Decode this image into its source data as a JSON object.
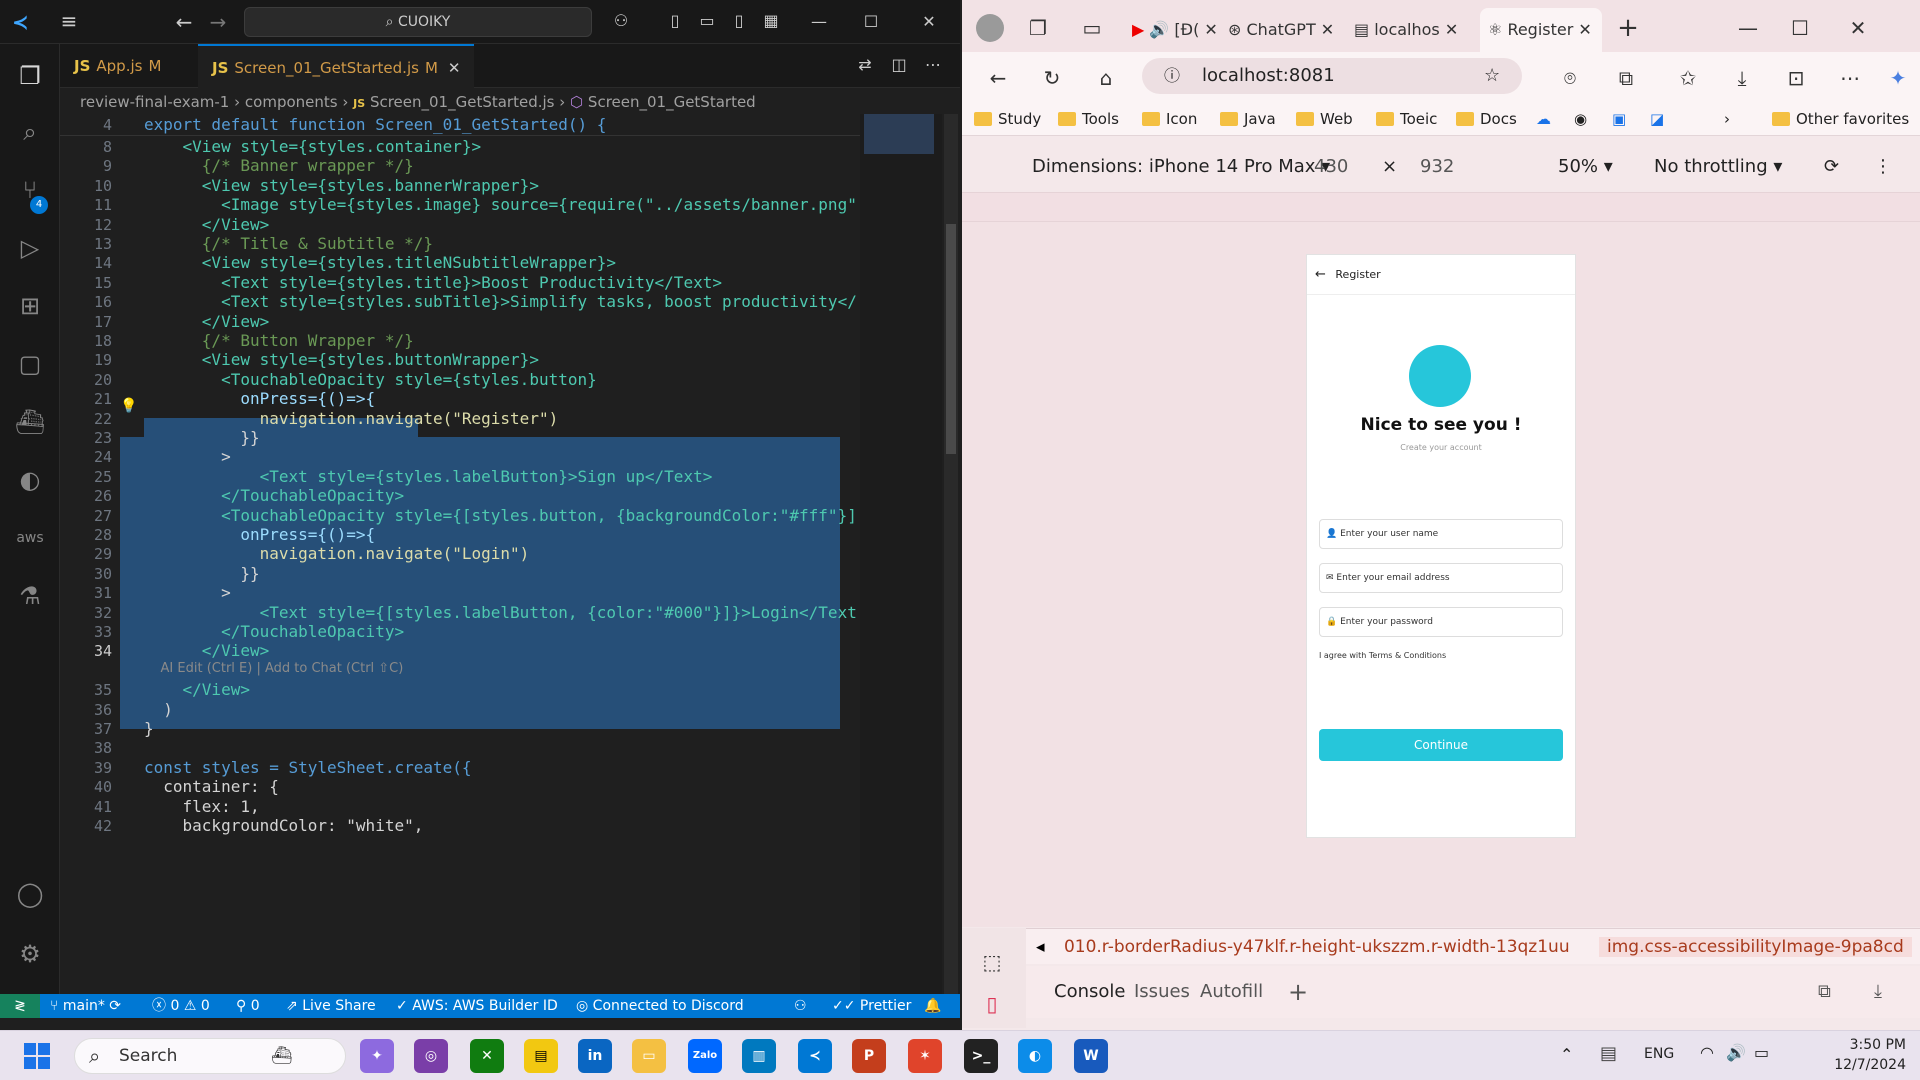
{
  "vscode": {
    "command_center": "CUOIKY",
    "tabs": [
      {
        "name": "App.js",
        "status": "M"
      },
      {
        "name": "Screen_01_GetStarted.js",
        "status": "M"
      }
    ],
    "breadcrumb": [
      "review-final-exam-1",
      "components",
      "Screen_01_GetStarted.js",
      "Screen_01_GetStarted"
    ],
    "sticky_line": {
      "num": "4",
      "text": "export default function Screen_01_GetStarted() {"
    },
    "lines": [
      {
        "n": "8",
        "t": "    <View style={styles.container}>"
      },
      {
        "n": "9",
        "t": "      {/* Banner wrapper */}"
      },
      {
        "n": "10",
        "t": "      <View style={styles.bannerWrapper}>"
      },
      {
        "n": "11",
        "t": "        <Image style={styles.image} source={require(\"../assets/banner.png\""
      },
      {
        "n": "12",
        "t": "      </View>"
      },
      {
        "n": "13",
        "t": "      {/* Title & Subtitle */}"
      },
      {
        "n": "14",
        "t": "      <View style={styles.titleNSubtitleWrapper}>"
      },
      {
        "n": "15",
        "t": "        <Text style={styles.title}>Boost Productivity</Text>"
      },
      {
        "n": "16",
        "t": "        <Text style={styles.subTitle}>Simplify tasks, boost productivity</"
      },
      {
        "n": "17",
        "t": "      </View>"
      },
      {
        "n": "18",
        "t": "      {/* Button Wrapper */}"
      },
      {
        "n": "19",
        "t": "      <View style={styles.buttonWrapper}>"
      },
      {
        "n": "20",
        "t": "        <TouchableOpacity style={styles.button}"
      },
      {
        "n": "21",
        "t": "          onPress={()=>{"
      },
      {
        "n": "22",
        "t": "            navigation.navigate(\"Register\")"
      },
      {
        "n": "23",
        "t": "          }}"
      },
      {
        "n": "24",
        "t": "        >"
      },
      {
        "n": "25",
        "t": "            <Text style={styles.labelButton}>Sign up</Text>"
      },
      {
        "n": "26",
        "t": "        </TouchableOpacity>"
      },
      {
        "n": "27",
        "t": "        <TouchableOpacity style={[styles.button, {backgroundColor:\"#fff\"}]"
      },
      {
        "n": "28",
        "t": "          onPress={()=>{"
      },
      {
        "n": "29",
        "t": "            navigation.navigate(\"Login\")"
      },
      {
        "n": "30",
        "t": "          }}"
      },
      {
        "n": "31",
        "t": "        >"
      },
      {
        "n": "32",
        "t": "            <Text style={[styles.labelButton, {color:\"#000\"}]}>Login</Text"
      },
      {
        "n": "33",
        "t": "        </TouchableOpacity>"
      },
      {
        "n": "34",
        "t": "      </View>"
      },
      {
        "n": "",
        "t": "    AI Edit (Ctrl E) | Add to Chat (Ctrl ⇧C)"
      },
      {
        "n": "35",
        "t": "    </View>"
      },
      {
        "n": "36",
        "t": "  )"
      },
      {
        "n": "37",
        "t": "}"
      },
      {
        "n": "38",
        "t": ""
      },
      {
        "n": "39",
        "t": "const styles = StyleSheet.create({"
      },
      {
        "n": "40",
        "t": "  container: {"
      },
      {
        "n": "41",
        "t": "    flex: 1,"
      },
      {
        "n": "42",
        "t": "    backgroundColor: \"white\","
      }
    ],
    "status": {
      "branch": "main*",
      "errors": "0",
      "warnings": "0",
      "ports": "0",
      "live_share": "Live Share",
      "aws": "AWS: AWS Builder ID",
      "discord": "Connected to Discord",
      "prettier": "Prettier"
    },
    "source_control_badge": "4"
  },
  "edge": {
    "tabs": [
      {
        "label": "[Đ("
      },
      {
        "label": "ChatGPT"
      },
      {
        "label": "localhos"
      },
      {
        "label": "Register"
      }
    ],
    "url": "localhost:8081",
    "favorites": [
      "Study",
      "Tools",
      "Icon",
      "Java",
      "Web",
      "Toeic",
      "Docs"
    ],
    "other_favorites": "Other favorites",
    "device": {
      "dimensions": "Dimensions: iPhone 14 Pro Max",
      "width": "430",
      "height": "932",
      "zoom": "50%",
      "throttling": "No throttling"
    },
    "app": {
      "header": "Register",
      "headline": "Nice to see you !",
      "subheadline": "Create your account",
      "username_placeholder": "Enter your user name",
      "email_placeholder": "Enter your email address",
      "password_placeholder": "Enter your password",
      "agree_text": "I agree with Terms & Conditions",
      "continue_label": "Continue"
    },
    "css_crumbs": [
      "010.r-borderRadius-y47klf.r-height-ukszzm.r-width-13qz1uu",
      "img.css-accessibilityImage-9pa8cd"
    ],
    "devtools_tabs": [
      "Console",
      "Issues",
      "Autofill"
    ]
  },
  "taskbar": {
    "search": "Search",
    "language": "ENG",
    "time": "3:50 PM",
    "date": "12/7/2024"
  },
  "colors": {
    "accent": "#0078d4",
    "app_primary": "#26c6da"
  }
}
